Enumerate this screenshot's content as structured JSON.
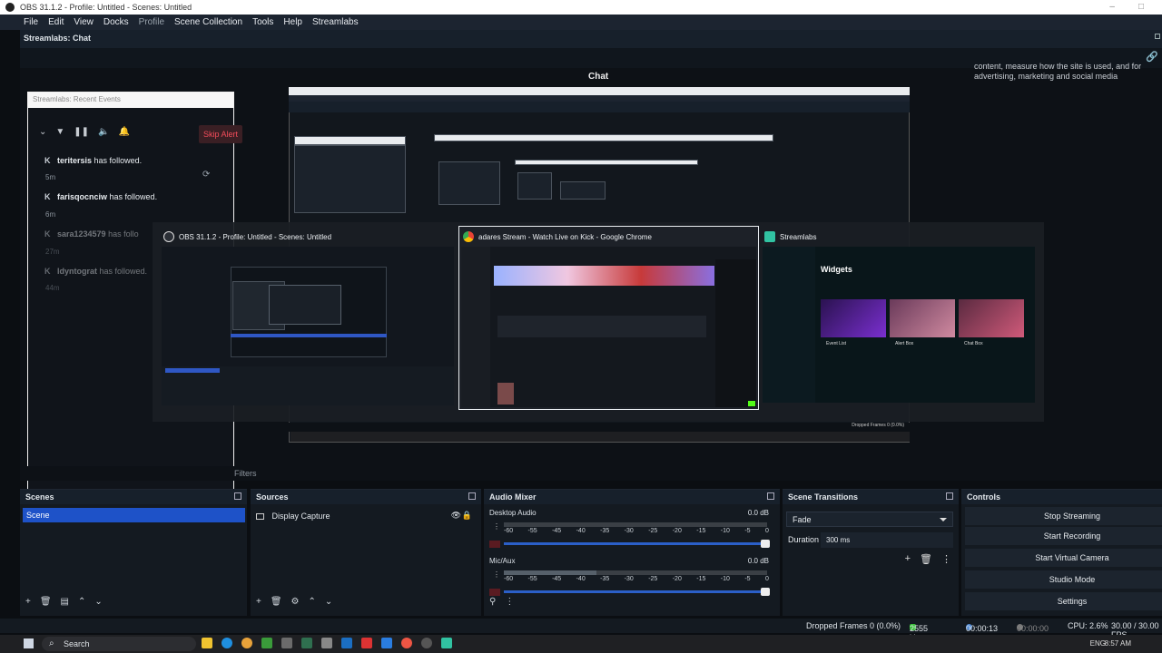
{
  "titlebar": {
    "title": "OBS 31.1.2 - Profile: Untitled - Scenes: Untitled"
  },
  "menu": [
    "File",
    "Edit",
    "View",
    "Docks",
    "Profile",
    "Scene Collection",
    "Tools",
    "Help",
    "Streamlabs"
  ],
  "dock": {
    "title": "Streamlabs: Chat",
    "chat_heading": "Chat"
  },
  "cookie_notice": "content, measure how the site is used, and for advertising, marketing and social media",
  "recent_events": {
    "title": "Streamlabs: Recent Events",
    "skip_alert": "Skip Alert",
    "events": [
      {
        "name": "teritersis",
        "action": "has followed.",
        "time": "5m"
      },
      {
        "name": "farisqocnciw",
        "action": "has followed.",
        "time": "6m"
      },
      {
        "name": "sara1234579",
        "action": "has follo",
        "time": "27m"
      },
      {
        "name": "ldyntograt",
        "action": "has followed.",
        "time": "44m"
      }
    ]
  },
  "alttab": {
    "items": [
      {
        "title": "OBS 31.1.2 - Profile: Untitled - Scenes: Untitled"
      },
      {
        "title": "adares Stream - Watch Live on Kick - Google Chrome"
      },
      {
        "title": "Streamlabs"
      }
    ],
    "streamlabs_heading": "Widgets",
    "cards": [
      "Event List",
      "Alert Box",
      "Chat Box"
    ]
  },
  "filters_label": "Filters",
  "scenes": {
    "title": "Scenes",
    "items": [
      "Scene"
    ]
  },
  "sources": {
    "title": "Sources",
    "items": [
      "Display Capture"
    ]
  },
  "mixer": {
    "title": "Audio Mixer",
    "channels": [
      {
        "name": "Desktop Audio",
        "db": "0.0 dB",
        "level": 0.02
      },
      {
        "name": "Mic/Aux",
        "db": "0.0 dB",
        "level": 0.35
      }
    ],
    "ticks": [
      "-60",
      "-55",
      "-45",
      "-40",
      "-35",
      "-30",
      "-25",
      "-20",
      "-15",
      "-10",
      "-5",
      "0"
    ]
  },
  "transitions": {
    "title": "Scene Transitions",
    "selected": "Fade",
    "duration_label": "Duration",
    "duration_value": "300 ms"
  },
  "controls": {
    "title": "Controls",
    "buttons": [
      "Stop Streaming",
      "Start Recording",
      "Start Virtual Camera",
      "Studio Mode",
      "Settings"
    ]
  },
  "status": {
    "dropped": "Dropped Frames 0 (0.0%)",
    "kbps": "2555 kbps",
    "live_time": "00:00:13",
    "rec_time": "00:00:00",
    "cpu": "CPU: 2.6%",
    "fps": "30.00 / 30.00 FPS"
  },
  "taskbar": {
    "search": "Search",
    "lang": "ENG",
    "clock": "8:57 AM"
  },
  "colors": {
    "accent": "#1e52c8",
    "skip": "#f24c5a",
    "stream_green": "#53fc18"
  }
}
